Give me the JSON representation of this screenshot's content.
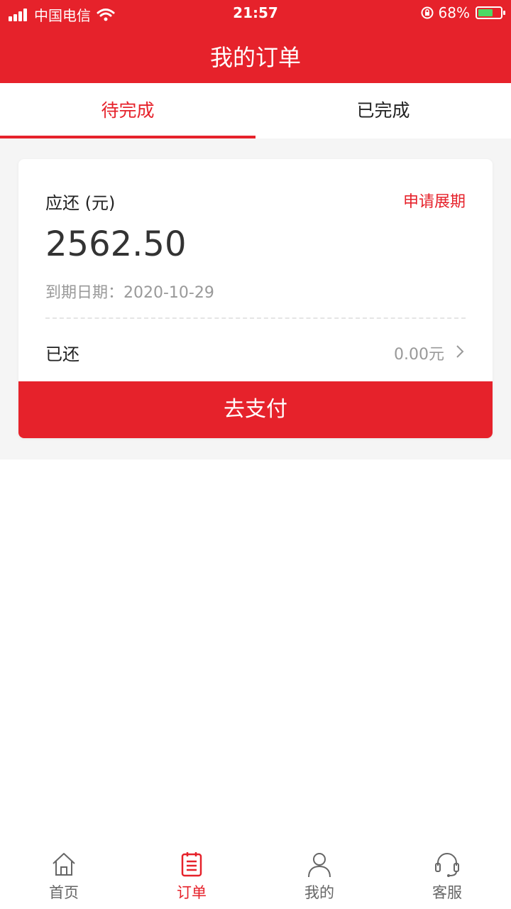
{
  "status_bar": {
    "carrier": "中国电信",
    "time": "21:57",
    "battery": "68%",
    "battery_level": 0.68
  },
  "header": {
    "title": "我的订单"
  },
  "tabs": [
    {
      "label": "待完成",
      "active": true
    },
    {
      "label": "已完成",
      "active": false
    }
  ],
  "order_card": {
    "due_label": "应还 (元)",
    "extend_link": "申请展期",
    "amount": "2562.50",
    "due_date": "到期日期：2020-10-29",
    "repaid_label": "已还",
    "repaid_value": "0.00元",
    "pay_button": "去支付"
  },
  "tab_bar": [
    {
      "label": "首页",
      "icon": "home-icon",
      "active": false
    },
    {
      "label": "订单",
      "icon": "order-list-icon",
      "active": true
    },
    {
      "label": "我的",
      "icon": "user-icon",
      "active": false
    },
    {
      "label": "客服",
      "icon": "headset-icon",
      "active": false
    }
  ],
  "colors": {
    "brand": "#e6222b",
    "muted": "#999999",
    "background": "#f5f5f5"
  }
}
